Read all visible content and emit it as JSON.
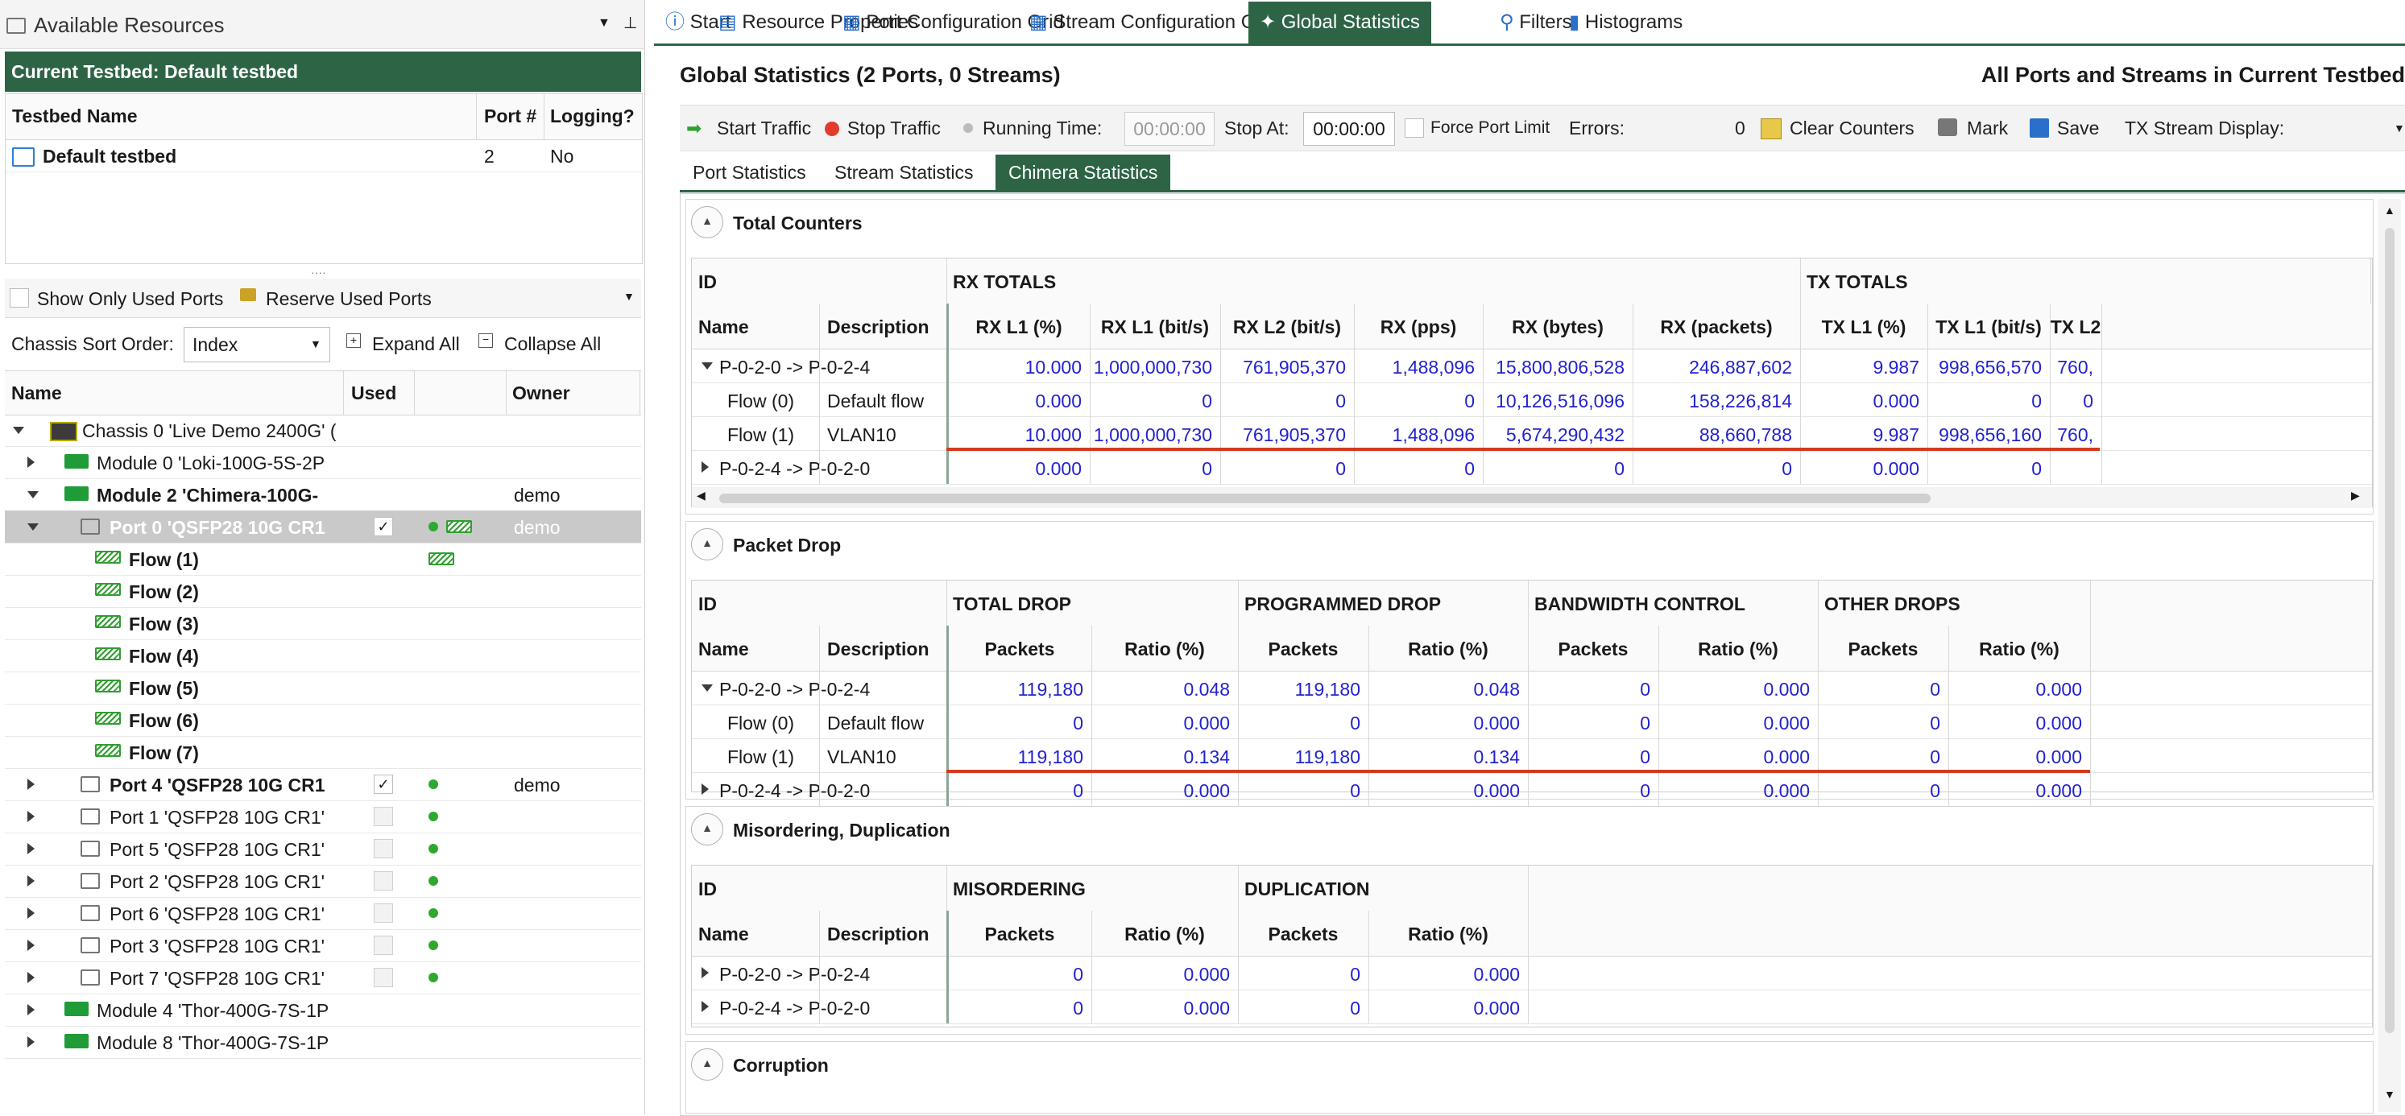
{
  "left": {
    "panel_title": "Available Resources",
    "testbed_header": "Current Testbed: Default testbed",
    "testbed_cols": [
      "Testbed Name",
      "Port #",
      "Logging?"
    ],
    "testbed_row": {
      "name": "Default testbed",
      "ports": "2",
      "logging": "No"
    },
    "show_only_used": "Show Only Used Ports",
    "reserve_used": "Reserve Used Ports",
    "sort_label": "Chassis Sort Order:",
    "sort_value": "Index",
    "expand_all": "Expand All",
    "collapse_all": "Collapse All",
    "tree_cols": [
      "Name",
      "Used",
      "Owner"
    ],
    "tree": [
      {
        "label": "Chassis 0 'Live Demo 2400G' (",
        "kind": "chassis",
        "level": 0,
        "exp": "d",
        "bold": false,
        "owner": ""
      },
      {
        "label": "Module 0 'Loki-100G-5S-2P",
        "kind": "module",
        "level": 1,
        "exp": "r",
        "bold": false,
        "owner": ""
      },
      {
        "label": "Module 2 'Chimera-100G-",
        "kind": "module",
        "level": 1,
        "exp": "d",
        "bold": true,
        "owner": "demo"
      },
      {
        "label": "Port 0 'QSFP28 10G CR1",
        "kind": "port",
        "level": 2,
        "exp": "d",
        "bold": true,
        "owner": "demo",
        "selected": true,
        "checked": true
      },
      {
        "label": "Flow (1)",
        "kind": "flow",
        "level": 3,
        "exp": "",
        "bold": true,
        "owner": ""
      },
      {
        "label": "Flow (2)",
        "kind": "flow",
        "level": 3,
        "exp": "",
        "bold": true,
        "owner": ""
      },
      {
        "label": "Flow (3)",
        "kind": "flow",
        "level": 3,
        "exp": "",
        "bold": true,
        "owner": ""
      },
      {
        "label": "Flow (4)",
        "kind": "flow",
        "level": 3,
        "exp": "",
        "bold": true,
        "owner": ""
      },
      {
        "label": "Flow (5)",
        "kind": "flow",
        "level": 3,
        "exp": "",
        "bold": true,
        "owner": ""
      },
      {
        "label": "Flow (6)",
        "kind": "flow",
        "level": 3,
        "exp": "",
        "bold": true,
        "owner": ""
      },
      {
        "label": "Flow (7)",
        "kind": "flow",
        "level": 3,
        "exp": "",
        "bold": true,
        "owner": ""
      },
      {
        "label": "Port 4 'QSFP28 10G CR1",
        "kind": "port",
        "level": 2,
        "exp": "r",
        "bold": true,
        "owner": "demo",
        "checked": true
      },
      {
        "label": "Port 1 'QSFP28 10G CR1'",
        "kind": "port",
        "level": 2,
        "exp": "r",
        "bold": false,
        "owner": ""
      },
      {
        "label": "Port 5 'QSFP28 10G CR1'",
        "kind": "port",
        "level": 2,
        "exp": "r",
        "bold": false,
        "owner": ""
      },
      {
        "label": "Port 2 'QSFP28 10G CR1'",
        "kind": "port",
        "level": 2,
        "exp": "r",
        "bold": false,
        "owner": ""
      },
      {
        "label": "Port 6 'QSFP28 10G CR1'",
        "kind": "port",
        "level": 2,
        "exp": "r",
        "bold": false,
        "owner": ""
      },
      {
        "label": "Port 3 'QSFP28 10G CR1'",
        "kind": "port",
        "level": 2,
        "exp": "r",
        "bold": false,
        "owner": ""
      },
      {
        "label": "Port 7 'QSFP28 10G CR1'",
        "kind": "port",
        "level": 2,
        "exp": "r",
        "bold": false,
        "owner": ""
      },
      {
        "label": "Module 4 'Thor-400G-7S-1P",
        "kind": "module",
        "level": 1,
        "exp": "r",
        "bold": false,
        "owner": ""
      },
      {
        "label": "Module 8 'Thor-400G-7S-1P",
        "kind": "module",
        "level": 1,
        "exp": "r",
        "bold": false,
        "owner": ""
      }
    ]
  },
  "tabs": [
    "Start",
    "Resource Properties",
    "Port Configuration Grid",
    "Stream Configuration Grid",
    "Global Statistics",
    "Filters",
    "Histograms"
  ],
  "main": {
    "title": "Global Statistics (2 Ports, 0 Streams)",
    "title_right": "All Ports and Streams in Current Testbed",
    "toolbar": {
      "start": "Start Traffic",
      "stop": "Stop Traffic",
      "running_label": "Running Time:",
      "running_value": "00:00:00",
      "stop_at_label": "Stop At:",
      "stop_at_value": "00:00:00",
      "force": "Force Port Limit",
      "errors_label": "Errors:",
      "errors_value": "0",
      "clear": "Clear Counters",
      "mark": "Mark",
      "save": "Save",
      "tx_display": "TX Stream Display:"
    },
    "subtabs": [
      "Port Statistics",
      "Stream Statistics",
      "Chimera Statistics"
    ],
    "sections": {
      "total": "Total Counters",
      "drop": "Packet Drop",
      "misorder": "Misordering, Duplication",
      "corruption": "Corruption"
    },
    "common": {
      "id": "ID",
      "name": "Name",
      "description": "Description"
    },
    "total": {
      "groups": [
        "RX TOTALS",
        "TX TOTALS"
      ],
      "cols": [
        "RX L1 (%)",
        "RX L1 (bit/s)",
        "RX L2 (bit/s)",
        "RX (pps)",
        "RX (bytes)",
        "RX (packets)",
        "TX L1 (%)",
        "TX L1 (bit/s)",
        "TX L2"
      ],
      "rows": [
        {
          "name": "P-0-2-0 -> P-0-2-4",
          "desc": "",
          "exp": "d",
          "vals": [
            "10.000",
            "1,000,000,730",
            "761,905,370",
            "1,488,096",
            "15,800,806,528",
            "246,887,602",
            "9.987",
            "998,656,570",
            "760,"
          ]
        },
        {
          "name": "Flow (0)",
          "desc": "Default flow",
          "exp": "",
          "vals": [
            "0.000",
            "0",
            "0",
            "0",
            "10,126,516,096",
            "158,226,814",
            "0.000",
            "0",
            "0"
          ]
        },
        {
          "name": "Flow (1)",
          "desc": "VLAN10",
          "exp": "",
          "vals": [
            "10.000",
            "1,000,000,730",
            "761,905,370",
            "1,488,096",
            "5,674,290,432",
            "88,660,788",
            "9.987",
            "998,656,160",
            "760,"
          ]
        },
        {
          "name": "P-0-2-4 -> P-0-2-0",
          "desc": "",
          "exp": "r",
          "vals": [
            "0.000",
            "0",
            "0",
            "0",
            "0",
            "0",
            "0.000",
            "0",
            ""
          ]
        }
      ]
    },
    "drop": {
      "groups": [
        "TOTAL DROP",
        "PROGRAMMED DROP",
        "BANDWIDTH CONTROL",
        "OTHER DROPS"
      ],
      "cols": [
        "Packets",
        "Ratio (%)",
        "Packets",
        "Ratio (%)",
        "Packets",
        "Ratio (%)",
        "Packets",
        "Ratio (%)"
      ],
      "rows": [
        {
          "name": "P-0-2-0 -> P-0-2-4",
          "desc": "",
          "exp": "d",
          "vals": [
            "119,180",
            "0.048",
            "119,180",
            "0.048",
            "0",
            "0.000",
            "0",
            "0.000"
          ]
        },
        {
          "name": "Flow (0)",
          "desc": "Default flow",
          "exp": "",
          "vals": [
            "0",
            "0.000",
            "0",
            "0.000",
            "0",
            "0.000",
            "0",
            "0.000"
          ]
        },
        {
          "name": "Flow (1)",
          "desc": "VLAN10",
          "exp": "",
          "vals": [
            "119,180",
            "0.134",
            "119,180",
            "0.134",
            "0",
            "0.000",
            "0",
            "0.000"
          ]
        },
        {
          "name": "P-0-2-4 -> P-0-2-0",
          "desc": "",
          "exp": "r",
          "vals": [
            "0",
            "0.000",
            "0",
            "0.000",
            "0",
            "0.000",
            "0",
            "0.000"
          ]
        }
      ]
    },
    "misorder": {
      "groups": [
        "MISORDERING",
        "DUPLICATION"
      ],
      "cols": [
        "Packets",
        "Ratio (%)",
        "Packets",
        "Ratio (%)"
      ],
      "rows": [
        {
          "name": "P-0-2-0 -> P-0-2-4",
          "desc": "",
          "exp": "r",
          "vals": [
            "0",
            "0.000",
            "0",
            "0.000"
          ]
        },
        {
          "name": "P-0-2-4 -> P-0-2-0",
          "desc": "",
          "exp": "r",
          "vals": [
            "0",
            "0.000",
            "0",
            "0.000"
          ]
        }
      ]
    }
  },
  "colors": {
    "accent": "#2e6446",
    "value": "#2222d0",
    "highlight": "#d23b1e"
  }
}
